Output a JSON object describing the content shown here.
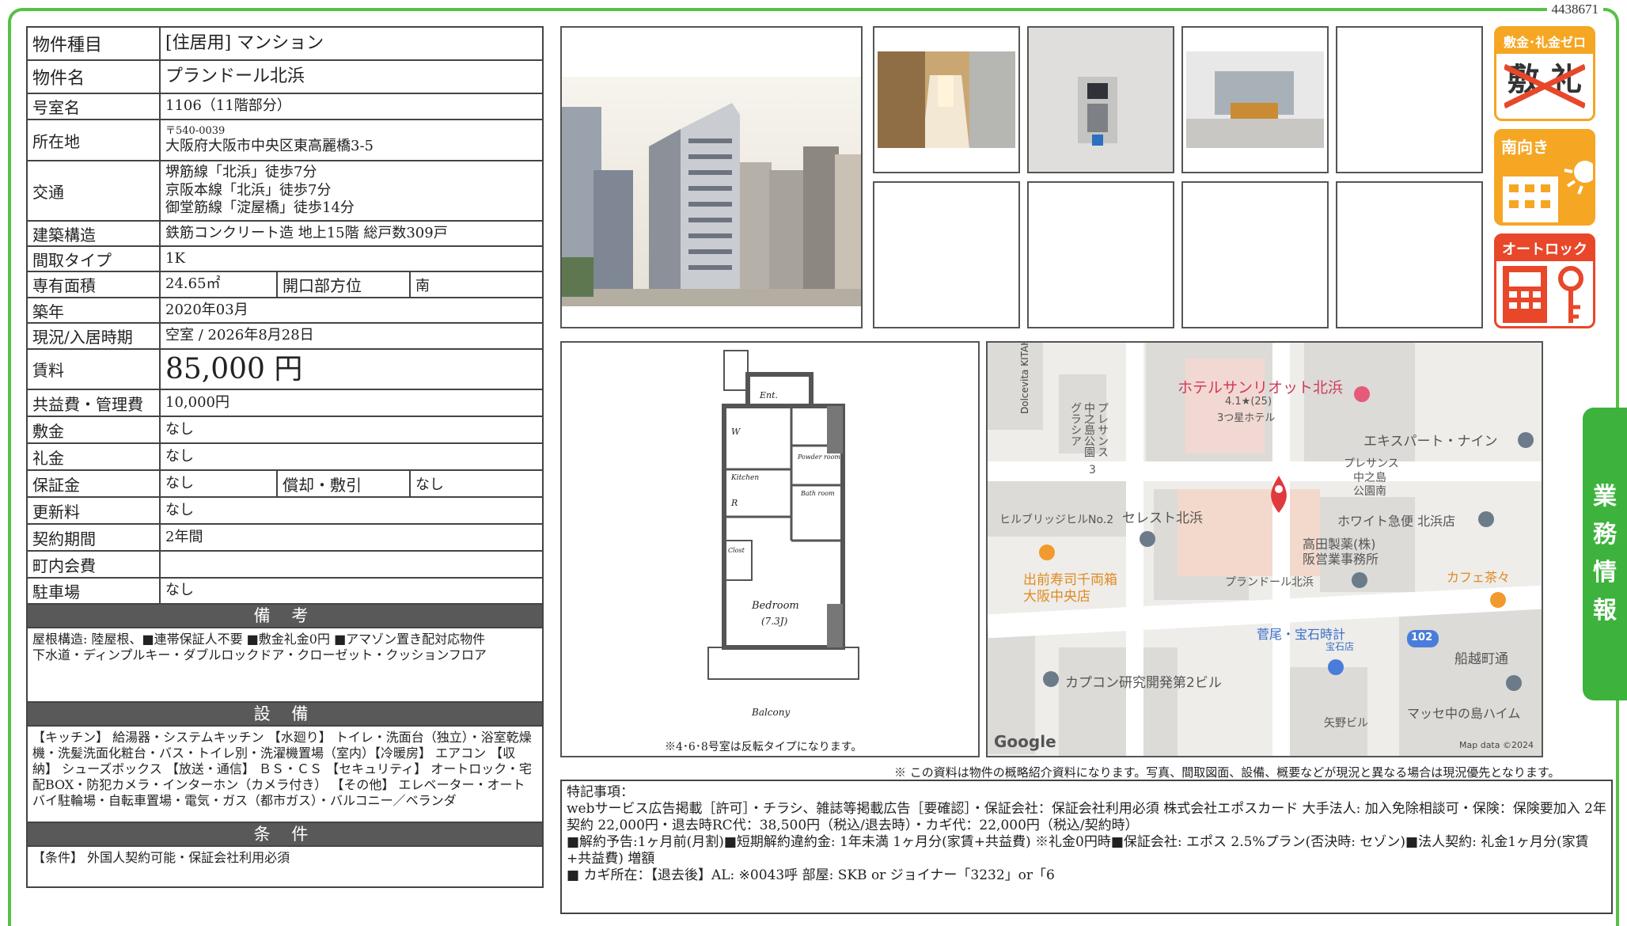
{
  "doc_id": "4438671",
  "property": {
    "type_label": "物件種目",
    "type_value": "[住居用] マンション",
    "name_label": "物件名",
    "name_value": "プランドール北浜",
    "room_label": "号室名",
    "room_value": "1106（11階部分）",
    "address_label": "所在地",
    "zip": "〒540-0039",
    "address_value": "大阪府大阪市中央区東高麗橋3-5",
    "access_label": "交通",
    "access": [
      "堺筋線「北浜」徒歩7分",
      "京阪本線「北浜」徒歩7分",
      "御堂筋線「淀屋橋」徒歩14分"
    ],
    "structure_label": "建築構造",
    "structure_value": "鉄筋コンクリート造 地上15階 総戸数309戸",
    "layout_label": "間取タイプ",
    "layout_value": "1K",
    "area_label": "専有面積",
    "area_value": "24.65㎡",
    "direction_label": "開口部方位",
    "direction_value": "南",
    "built_label": "築年",
    "built_value": "2020年03月",
    "status_label": "現況/入居時期",
    "status_value": "空室 / 2026年8月28日",
    "rent_label": "賃料",
    "rent_value": "85,000 円",
    "fee_label": "共益費・管理費",
    "fee_value": "10,000円",
    "deposit_label": "敷金",
    "deposit_value": "なし",
    "key_money_label": "礼金",
    "key_money_value": "なし",
    "guarantee_label": "保証金",
    "guarantee_value": "なし",
    "amort_label": "償却・敷引",
    "amort_value": "なし",
    "renewal_label": "更新料",
    "renewal_value": "なし",
    "term_label": "契約期間",
    "term_value": "2年間",
    "town_label": "町内会費",
    "town_value": "",
    "parking_label": "駐車場",
    "parking_value": "なし"
  },
  "remarks": {
    "title": "備 考",
    "text1": "屋根構造: 陸屋根、■連帯保証人不要 ■敷金礼金0円 ■アマゾン置き配対応物件",
    "text2": "下水道・ディンプルキー・ダブルロックドア・クローゼット・クッションフロア"
  },
  "equipment": {
    "title": "設 備",
    "text": "【キッチン】 給湯器・システムキッチン 【水廻り】 トイレ・洗面台（独立）・浴室乾燥機・洗髪洗面化粧台・バス・トイレ別・洗濯機置場（室内）【冷暖房】 エアコン 【収納】 シューズボックス 【放送・通信】 ＢＳ・ＣＳ 【セキュリティ】 オートロック・宅配BOX・防犯カメラ・インターホン（カメラ付き） 【その他】 エレベーター・オートバイ駐輪場・自転車置場・電気・ガス（都市ガス）・バルコニー／ベランダ"
  },
  "conditions": {
    "title": "条 件",
    "text": "【条件】 外国人契約可能・保証会社利用必須"
  },
  "badges": {
    "zero_title": "敷金･礼金ゼロ",
    "zero_body": "敷 礼",
    "south_title": "南向き",
    "autolock_title": "オートロック"
  },
  "floorplan": {
    "entrance": "Ent.",
    "washer": "W",
    "kitchen": "Kitchen",
    "fridge": "R",
    "powder": "Powder room",
    "bath": "Bath room",
    "closet": "Clost",
    "bedroom": "Bedroom",
    "bedroom_size": "(7.3J)",
    "balcony": "Balcony",
    "note": "※4･6･8号室は反転タイプになります。"
  },
  "map": {
    "hotel": "ホテルサンリオット北浜",
    "rating": "4.1★(25)",
    "hotel_class": "3つ星ホテル",
    "dolce": "Dolcevita KITAHAMA",
    "presence_v1": "プレサンス",
    "presence_v2": "中之島公園",
    "presence_v3": "グラシア",
    "presence2_1": "プレサンス",
    "presence2_2": "中之島",
    "presence2_3": "公園南",
    "expert": "エキスパート・ナイン",
    "celest": "セレスト北浜",
    "hill": "ヒルブリッジヒルNo.2",
    "white": "ホワイト急便 北浜店",
    "takada1": "高田製薬(株)",
    "takada2": "阪営業事務所",
    "target": "プランドール北浜",
    "cafe": "カフェ茶々",
    "sushi1": "出前寿司千両箱",
    "sushi2": "大阪中央店",
    "watch": "菅尾・宝石時計",
    "watch2": "宝石店",
    "road": "102",
    "funakoshi": "船越町通",
    "capcom": "カプコン研究開発第2ビル",
    "yano": "矢野ビル",
    "messe": "マッセ中の島ハイム",
    "num3": "3",
    "google": "Google",
    "mapdata": "Map data ©2024",
    "pin_color": "#e0393e"
  },
  "side_tab": [
    "業",
    "務",
    "情",
    "報"
  ],
  "disclaimer": "※ この資料は物件の概略紹介資料になります。写真、間取図面、設備、概要などが現況と異なる場合は現況優先となります。",
  "notes": {
    "heading": "特記事項：",
    "line1": "webサービス広告掲載［許可］・チラシ、雑誌等掲載広告［要確認］・保証会社：保証会社利用必須 株式会社エポスカード 大手法人: 加入免除相談可・保険：保険要加入 2年契約 22,000円・退去時RC代：38,500円（税込/退去時）・カギ代：22,000円（税込/契約時）",
    "line2": "■解約予告:1ヶ月前(月割)■短期解約違約金: 1年未満 1ヶ月分(家賃+共益費) ※礼金0円時■保証会社: エポス 2.5%プラン(否決時: セゾン)■法人契約: 礼金1ヶ月分(家賃+共益費) 増額",
    "line3": "■ カギ所在：【退去後】AL: ※0043呼 部屋: SKB or ジョイナー「3232」or「6"
  },
  "colors": {
    "frame": "#58c048",
    "tab": "#3db33d",
    "badge_orange": "#f5a623",
    "badge_red": "#e8472a"
  }
}
